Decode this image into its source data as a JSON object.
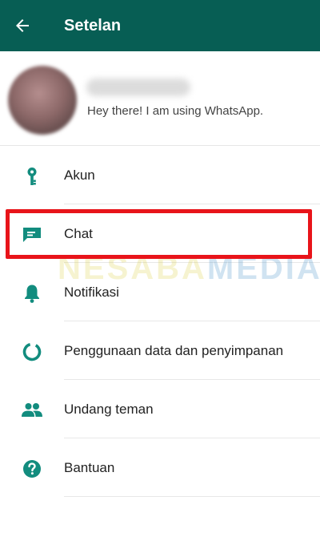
{
  "appbar": {
    "title": "Setelan",
    "back_icon": "arrow-left-icon",
    "background": "#075e54"
  },
  "profile": {
    "name": "",
    "status": "Hey there! I am using WhatsApp."
  },
  "menu": {
    "items": [
      {
        "label": "Akun",
        "icon": "key-icon"
      },
      {
        "label": "Chat",
        "icon": "chat-icon"
      },
      {
        "label": "Notifikasi",
        "icon": "bell-icon"
      },
      {
        "label": "Penggunaan data dan penyimpanan",
        "icon": "data-usage-icon"
      },
      {
        "label": "Undang teman",
        "icon": "people-icon"
      },
      {
        "label": "Bantuan",
        "icon": "help-icon"
      }
    ]
  },
  "watermark": {
    "part1": "NESABA",
    "part2": "MEDIA"
  },
  "colors": {
    "icon": "#128c7e",
    "highlight": "#e8141a"
  }
}
